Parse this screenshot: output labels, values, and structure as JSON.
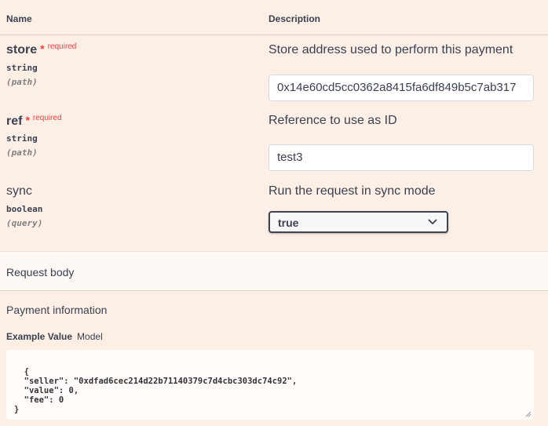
{
  "header": {
    "name_col": "Name",
    "desc_col": "Description"
  },
  "params": [
    {
      "name": "store",
      "required_star": "*",
      "required_label": "required",
      "type": "string",
      "in": "(path)",
      "description": "Store address used to perform this payment",
      "value": "0x14e60cd5cc0362a8415fa6df849b5c7ab317"
    },
    {
      "name": "ref",
      "required_star": "*",
      "required_label": "required",
      "type": "string",
      "in": "(path)",
      "description": "Reference to use as ID",
      "value": "test3"
    },
    {
      "name": "sync",
      "type": "boolean",
      "in": "(query)",
      "description": "Run the request in sync mode",
      "selected": "true"
    }
  ],
  "request_body": {
    "title": "Request body"
  },
  "payment": {
    "title": "Payment information",
    "tab_example": "Example Value",
    "tab_model": "Model",
    "example": "{\n  \"seller\": \"0xdfad6cec214d22b71140379c7d4cbc303dc74c92\",\n  \"value\": 0,\n  \"fee\": 0\n}"
  },
  "colors": {
    "background": "#fcefe6",
    "required": "#f93e3e",
    "text": "#3b4151"
  },
  "icons": {
    "select": "chevron-down-icon",
    "textarea": "resize-handle-icon"
  }
}
